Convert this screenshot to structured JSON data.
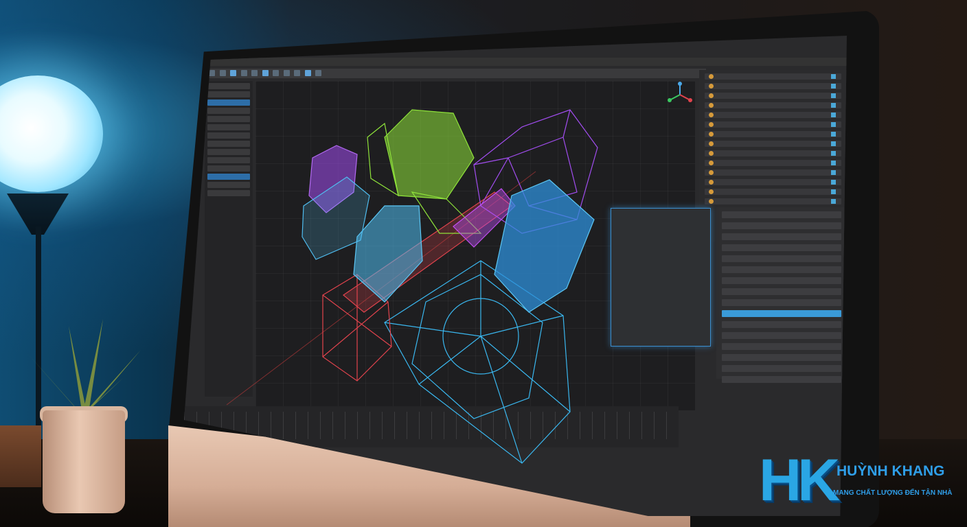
{
  "brand": {
    "logo_letters": "HK",
    "name": "HUỲNH KHANG",
    "slogan": "MANG CHẤT LƯỢNG ĐẾN TẬN NHÀ"
  },
  "colors": {
    "brand_blue": "#2f9ee8",
    "ui_background": "#2a2a2c",
    "accent_selection": "#3a9ad8",
    "model_green": "#8fe33a",
    "model_purple": "#a24df0",
    "model_blue": "#3aa8f0",
    "model_red": "#e2434d",
    "model_orange": "#f1a21c"
  },
  "icons": [
    "lamp",
    "potted-plant",
    "monitor",
    "3d-navigation-gizmo",
    "wireframe-models"
  ]
}
